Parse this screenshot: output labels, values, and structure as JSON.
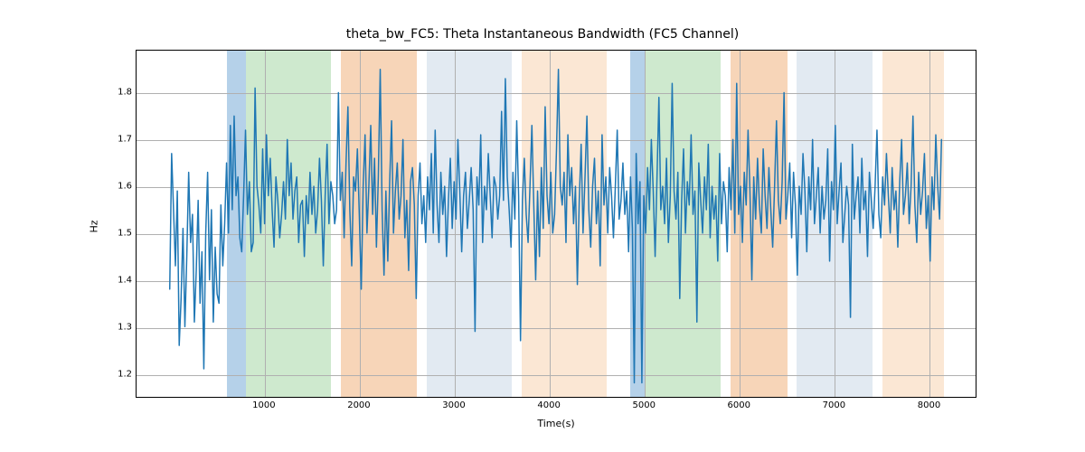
{
  "chart_data": {
    "type": "line",
    "title": "theta_bw_FC5: Theta Instantaneous Bandwidth (FC5 Channel)",
    "xlabel": "Time(s)",
    "ylabel": "Hz",
    "xlim": [
      -350,
      8500
    ],
    "ylim": [
      1.15,
      1.89
    ],
    "xticks": [
      1000,
      2000,
      3000,
      4000,
      5000,
      6000,
      7000,
      8000
    ],
    "yticks": [
      1.2,
      1.3,
      1.4,
      1.5,
      1.6,
      1.7,
      1.8
    ],
    "grid": true,
    "line_color": "#1f77b4",
    "bands": [
      {
        "start": 600,
        "end": 800,
        "color": "#a8c9e5",
        "alpha": 0.85
      },
      {
        "start": 800,
        "end": 1700,
        "color": "#c5e5c5",
        "alpha": 0.85
      },
      {
        "start": 1800,
        "end": 2600,
        "color": "#f6ceab",
        "alpha": 0.85
      },
      {
        "start": 2700,
        "end": 3600,
        "color": "#dde6f0",
        "alpha": 0.85
      },
      {
        "start": 3700,
        "end": 4600,
        "color": "#fae3cc",
        "alpha": 0.85
      },
      {
        "start": 4850,
        "end": 5000,
        "color": "#a8c9e5",
        "alpha": 0.85
      },
      {
        "start": 5000,
        "end": 5800,
        "color": "#c5e5c5",
        "alpha": 0.85
      },
      {
        "start": 5900,
        "end": 6500,
        "color": "#f6ceab",
        "alpha": 0.85
      },
      {
        "start": 6600,
        "end": 7400,
        "color": "#dde6f0",
        "alpha": 0.85
      },
      {
        "start": 7500,
        "end": 8150,
        "color": "#fae3cc",
        "alpha": 0.85
      }
    ],
    "series": [
      {
        "name": "theta_bw_FC5",
        "x_start": 0,
        "x_step": 20,
        "values": [
          1.38,
          1.67,
          1.55,
          1.43,
          1.59,
          1.26,
          1.36,
          1.51,
          1.3,
          1.45,
          1.63,
          1.48,
          1.54,
          1.31,
          1.42,
          1.57,
          1.35,
          1.46,
          1.21,
          1.5,
          1.63,
          1.4,
          1.55,
          1.31,
          1.47,
          1.37,
          1.35,
          1.56,
          1.43,
          1.52,
          1.65,
          1.5,
          1.73,
          1.55,
          1.75,
          1.58,
          1.62,
          1.49,
          1.46,
          1.58,
          1.72,
          1.54,
          1.61,
          1.46,
          1.48,
          1.81,
          1.6,
          1.56,
          1.5,
          1.68,
          1.52,
          1.71,
          1.58,
          1.66,
          1.55,
          1.47,
          1.62,
          1.57,
          1.49,
          1.54,
          1.61,
          1.53,
          1.7,
          1.58,
          1.65,
          1.53,
          1.59,
          1.62,
          1.48,
          1.56,
          1.57,
          1.45,
          1.58,
          1.52,
          1.63,
          1.54,
          1.6,
          1.5,
          1.55,
          1.66,
          1.57,
          1.43,
          1.58,
          1.69,
          1.52,
          1.61,
          1.58,
          1.52,
          1.55,
          1.8,
          1.57,
          1.63,
          1.49,
          1.65,
          1.77,
          1.55,
          1.43,
          1.62,
          1.59,
          1.68,
          1.54,
          1.38,
          1.6,
          1.71,
          1.5,
          1.6,
          1.73,
          1.54,
          1.66,
          1.47,
          1.62,
          1.85,
          1.55,
          1.41,
          1.59,
          1.44,
          1.61,
          1.74,
          1.5,
          1.59,
          1.65,
          1.53,
          1.58,
          1.7,
          1.49,
          1.57,
          1.42,
          1.61,
          1.64,
          1.56,
          1.36,
          1.58,
          1.65,
          1.52,
          1.58,
          1.48,
          1.62,
          1.55,
          1.67,
          1.5,
          1.72,
          1.56,
          1.48,
          1.63,
          1.54,
          1.6,
          1.45,
          1.57,
          1.66,
          1.51,
          1.61,
          1.53,
          1.7,
          1.59,
          1.46,
          1.58,
          1.63,
          1.51,
          1.57,
          1.64,
          1.55,
          1.29,
          1.62,
          1.56,
          1.71,
          1.48,
          1.6,
          1.55,
          1.67,
          1.58,
          1.49,
          1.62,
          1.6,
          1.53,
          1.58,
          1.76,
          1.57,
          1.83,
          1.62,
          1.55,
          1.47,
          1.63,
          1.53,
          1.74,
          1.58,
          1.27,
          1.57,
          1.66,
          1.54,
          1.48,
          1.6,
          1.73,
          1.56,
          1.4,
          1.59,
          1.45,
          1.64,
          1.51,
          1.77,
          1.58,
          1.52,
          1.63,
          1.5,
          1.54,
          1.68,
          1.85,
          1.6,
          1.56,
          1.63,
          1.48,
          1.71,
          1.58,
          1.64,
          1.52,
          1.6,
          1.39,
          1.57,
          1.69,
          1.5,
          1.62,
          1.75,
          1.55,
          1.47,
          1.6,
          1.66,
          1.52,
          1.59,
          1.43,
          1.71,
          1.56,
          1.62,
          1.5,
          1.64,
          1.58,
          1.49,
          1.6,
          1.72,
          1.53,
          1.57,
          1.65,
          1.54,
          1.59,
          1.46,
          1.62,
          1.51,
          1.18,
          1.67,
          1.52,
          1.61,
          1.18,
          1.58,
          1.5,
          1.64,
          1.55,
          1.7,
          1.59,
          1.45,
          1.62,
          1.79,
          1.55,
          1.6,
          1.52,
          1.66,
          1.48,
          1.58,
          1.82,
          1.59,
          1.53,
          1.63,
          1.36,
          1.57,
          1.68,
          1.5,
          1.61,
          1.56,
          1.71,
          1.54,
          1.59,
          1.31,
          1.65,
          1.57,
          1.5,
          1.62,
          1.55,
          1.69,
          1.49,
          1.6,
          1.53,
          1.58,
          1.44,
          1.67,
          1.52,
          1.61,
          1.58,
          1.46,
          1.64,
          1.55,
          1.7,
          1.5,
          1.82,
          1.54,
          1.6,
          1.48,
          1.63,
          1.56,
          1.72,
          1.59,
          1.4,
          1.62,
          1.53,
          1.66,
          1.56,
          1.5,
          1.68,
          1.58,
          1.51,
          1.64,
          1.55,
          1.47,
          1.6,
          1.74,
          1.57,
          1.52,
          1.61,
          1.8,
          1.53,
          1.58,
          1.65,
          1.49,
          1.63,
          1.56,
          1.41,
          1.6,
          1.54,
          1.67,
          1.59,
          1.46,
          1.62,
          1.55,
          1.7,
          1.52,
          1.58,
          1.64,
          1.5,
          1.6,
          1.53,
          1.57,
          1.68,
          1.44,
          1.61,
          1.55,
          1.73,
          1.52,
          1.59,
          1.65,
          1.48,
          1.54,
          1.6,
          1.56,
          1.32,
          1.69,
          1.53,
          1.58,
          1.62,
          1.5,
          1.66,
          1.55,
          1.59,
          1.45,
          1.63,
          1.57,
          1.51,
          1.6,
          1.72,
          1.54,
          1.49,
          1.62,
          1.56,
          1.67,
          1.58,
          1.5,
          1.64,
          1.55,
          1.59,
          1.47,
          1.61,
          1.7,
          1.54,
          1.58,
          1.65,
          1.52,
          1.6,
          1.75,
          1.56,
          1.48,
          1.63,
          1.54,
          1.59,
          1.67,
          1.51,
          1.58,
          1.44,
          1.62,
          1.55,
          1.71,
          1.6,
          1.53,
          1.7
        ]
      }
    ]
  }
}
